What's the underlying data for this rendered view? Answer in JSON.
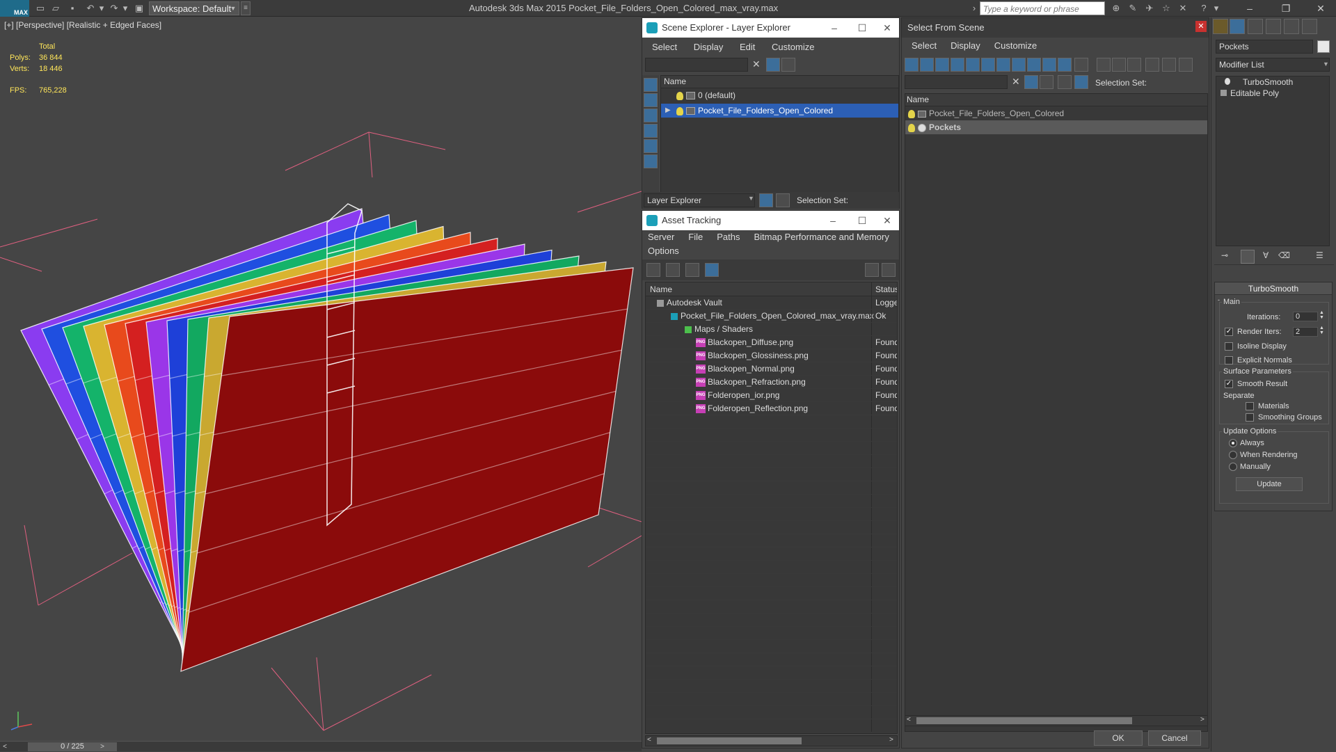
{
  "app": {
    "logo": "MAX",
    "workspace": "Workspace: Default",
    "title": "Autodesk 3ds Max  2015     Pocket_File_Folders_Open_Colored_max_vray.max",
    "search_placeholder": "Type a keyword or phrase"
  },
  "viewport": {
    "label": "[+] [Perspective] [Realistic + Edged Faces]",
    "stats": {
      "total_label": "Total",
      "polys_label": "Polys:",
      "polys_value": "36 844",
      "verts_label": "Verts:",
      "verts_value": "18 446",
      "fps_label": "FPS:",
      "fps_value": "765,228"
    },
    "folder_colors": [
      "#8a3cf0",
      "#1f4fe0",
      "#14b36a",
      "#d9b430",
      "#e84a1c",
      "#d42020",
      "#9a36e8",
      "#1e40d8",
      "#12a860",
      "#c9a830",
      "#8b0b0b"
    ]
  },
  "timeline": {
    "position": "0 / 225"
  },
  "scene_explorer": {
    "title": "Scene Explorer - Layer Explorer",
    "menu": [
      "Select",
      "Display",
      "Edit",
      "Customize"
    ],
    "column_name": "Name",
    "rows": [
      {
        "label": "0 (default)",
        "selected": false
      },
      {
        "label": "Pocket_File_Folders_Open_Colored",
        "selected": true
      }
    ],
    "footer_dropdown": "Layer Explorer",
    "selection_set_label": "Selection Set:"
  },
  "asset_tracking": {
    "title": "Asset Tracking",
    "menu": [
      "Server",
      "File",
      "Paths",
      "Bitmap Performance and Memory"
    ],
    "menu2": "Options",
    "col_name": "Name",
    "col_status": "Status",
    "rows": [
      {
        "name": "Autodesk Vault",
        "status": "Logged"
      },
      {
        "name": "Pocket_File_Folders_Open_Colored_max_vray.max",
        "status": "Ok"
      },
      {
        "name": "Maps / Shaders",
        "status": ""
      },
      {
        "name": "Blackopen_Diffuse.png",
        "status": "Found"
      },
      {
        "name": "Blackopen_Glossiness.png",
        "status": "Found"
      },
      {
        "name": "Blackopen_Normal.png",
        "status": "Found"
      },
      {
        "name": "Blackopen_Refraction.png",
        "status": "Found"
      },
      {
        "name": "Folderopen_ior.png",
        "status": "Found"
      },
      {
        "name": "Folderopen_Reflection.png",
        "status": "Found"
      }
    ]
  },
  "select_from_scene": {
    "title": "Select From Scene",
    "menu": [
      "Select",
      "Display",
      "Customize"
    ],
    "selection_set_label": "Selection Set:",
    "column_name": "Name",
    "rows": [
      {
        "label": "Pocket_File_Folders_Open_Colored",
        "selected": false
      },
      {
        "label": "Pockets",
        "selected": true
      }
    ],
    "ok": "OK",
    "cancel": "Cancel"
  },
  "command_panel": {
    "object_name": "Pockets",
    "modifier_list": "Modifier List",
    "stack": [
      "TurboSmooth",
      "Editable Poly"
    ],
    "rollout_title": "TurboSmooth",
    "main_label": "Main",
    "iterations_label": "Iterations:",
    "iterations_value": "0",
    "render_iters_label": "Render Iters:",
    "render_iters_value": "2",
    "isoline_label": "Isoline Display",
    "explicit_normals_label": "Explicit Normals",
    "surface_params_label": "Surface Parameters",
    "smooth_result_label": "Smooth Result",
    "separate_label": "Separate",
    "materials_label": "Materials",
    "smoothing_groups_label": "Smoothing Groups",
    "update_options_label": "Update Options",
    "always_label": "Always",
    "when_rendering_label": "When Rendering",
    "manually_label": "Manually",
    "update_button": "Update"
  },
  "colors": {
    "accent_blue": "#2c5fb5",
    "toolbar_blue": "#3c6e9a",
    "stats_yellow": "#ffe65a"
  }
}
